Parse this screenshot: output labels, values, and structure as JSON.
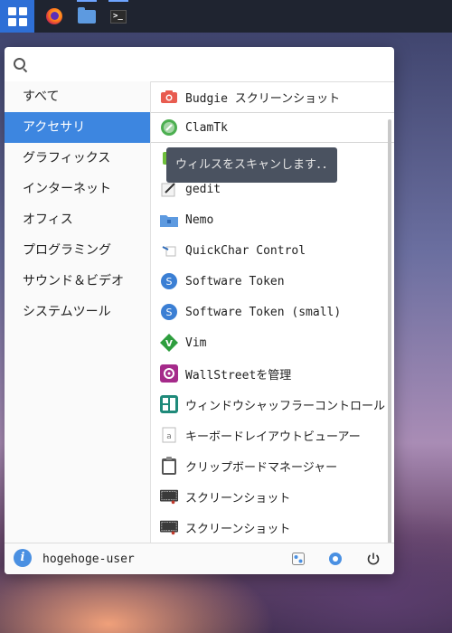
{
  "panel": {
    "items": [
      {
        "name": "app-menu-icon",
        "active": true
      },
      {
        "name": "firefox-icon"
      },
      {
        "name": "files-icon"
      },
      {
        "name": "terminal-icon",
        "label": ">_"
      }
    ]
  },
  "search": {
    "placeholder": "",
    "value": ""
  },
  "categories": [
    {
      "label": "すべて"
    },
    {
      "label": "アクセサリ",
      "selected": true
    },
    {
      "label": "グラフィックス"
    },
    {
      "label": "インターネット"
    },
    {
      "label": "オフィス"
    },
    {
      "label": "プログラミング"
    },
    {
      "label": "サウンド＆ビデオ"
    },
    {
      "label": "システムツール"
    }
  ],
  "apps": [
    {
      "label": "Budgie スクリーンショット",
      "icon": "camera-icon"
    },
    {
      "label": "ClamTk",
      "icon": "clamtk-icon",
      "highlighted": true
    },
    {
      "label": "",
      "icon": "green-app-icon"
    },
    {
      "label": "gedit",
      "icon": "text-editor-icon"
    },
    {
      "label": "Nemo",
      "icon": "folder-icon"
    },
    {
      "label": "QuickChar Control",
      "icon": "quickchar-icon"
    },
    {
      "label": "Software Token",
      "icon": "token-icon"
    },
    {
      "label": "Software Token (small)",
      "icon": "token-icon"
    },
    {
      "label": "Vim",
      "icon": "vim-icon"
    },
    {
      "label": "WallStreetを管理",
      "icon": "wallstreet-icon"
    },
    {
      "label": "ウィンドウシャッフラーコントロール",
      "icon": "window-shuffler-icon"
    },
    {
      "label": "キーボードレイアウトビューアー",
      "icon": "keyboard-layout-icon"
    },
    {
      "label": "クリップボードマネージャー",
      "icon": "clipboard-icon"
    },
    {
      "label": "スクリーンショット",
      "icon": "screenshot-icon"
    },
    {
      "label": "スクリーンショット",
      "icon": "screenshot-icon"
    }
  ],
  "tooltip": {
    "text": "ウィルスをスキャンします．．"
  },
  "footer": {
    "user_name": "hogehoge-user"
  },
  "colors": {
    "accent": "#3d86e0",
    "panel": "#1f2430",
    "tooltip": "#4a5260"
  }
}
